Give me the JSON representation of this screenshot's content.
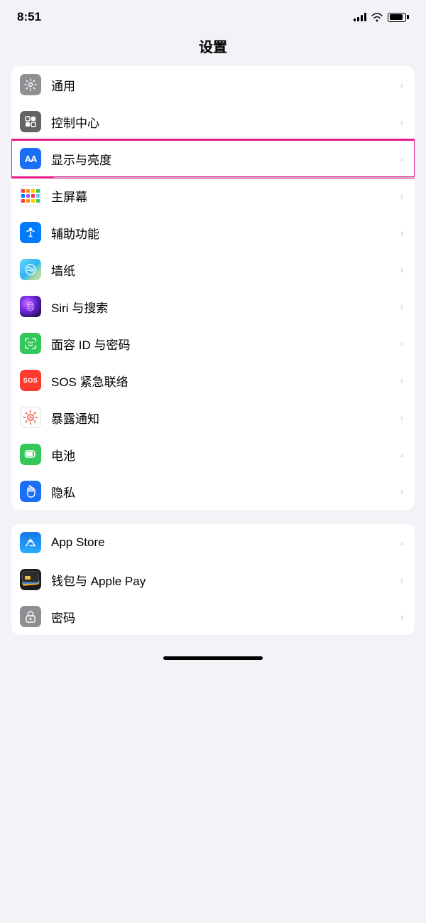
{
  "statusBar": {
    "time": "8:51",
    "signal": "●●●●",
    "wifi": "wifi",
    "battery": "battery"
  },
  "pageTitle": "设置",
  "groups": [
    {
      "id": "group1",
      "items": [
        {
          "id": "general",
          "label": "通用",
          "icon": "gear",
          "iconBg": "gray",
          "highlighted": false
        },
        {
          "id": "control-center",
          "label": "控制中心",
          "icon": "control",
          "iconBg": "gray2",
          "highlighted": false
        },
        {
          "id": "display",
          "label": "显示与亮度",
          "icon": "aa",
          "iconBg": "blue",
          "highlighted": true
        },
        {
          "id": "home-screen",
          "label": "主屏幕",
          "icon": "grid",
          "iconBg": "colorful",
          "highlighted": false
        },
        {
          "id": "accessibility",
          "label": "辅助功能",
          "icon": "accessibility",
          "iconBg": "blue2",
          "highlighted": false
        },
        {
          "id": "wallpaper",
          "label": "墙纸",
          "icon": "flower",
          "iconBg": "green-blue",
          "highlighted": false
        },
        {
          "id": "siri",
          "label": "Siri 与搜索",
          "icon": "siri",
          "iconBg": "siri",
          "highlighted": false
        },
        {
          "id": "faceid",
          "label": "面容 ID 与密码",
          "icon": "faceid",
          "iconBg": "green",
          "highlighted": false
        },
        {
          "id": "sos",
          "label": "SOS 紧急联络",
          "icon": "sos",
          "iconBg": "red",
          "highlighted": false
        },
        {
          "id": "exposure",
          "label": "暴露通知",
          "icon": "exposure",
          "iconBg": "exposure",
          "highlighted": false
        },
        {
          "id": "battery",
          "label": "电池",
          "icon": "battery-settings",
          "iconBg": "battery-green",
          "highlighted": false
        },
        {
          "id": "privacy",
          "label": "隐私",
          "icon": "hand",
          "iconBg": "blue-hand",
          "highlighted": false
        }
      ]
    },
    {
      "id": "group2",
      "items": [
        {
          "id": "appstore",
          "label": "App Store",
          "icon": "appstore",
          "iconBg": "appstore",
          "highlighted": false
        },
        {
          "id": "wallet",
          "label": "钱包与 Apple Pay",
          "icon": "wallet",
          "iconBg": "wallet",
          "highlighted": false
        },
        {
          "id": "password",
          "label": "密码",
          "icon": "password",
          "iconBg": "password",
          "highlighted": false
        }
      ]
    }
  ]
}
